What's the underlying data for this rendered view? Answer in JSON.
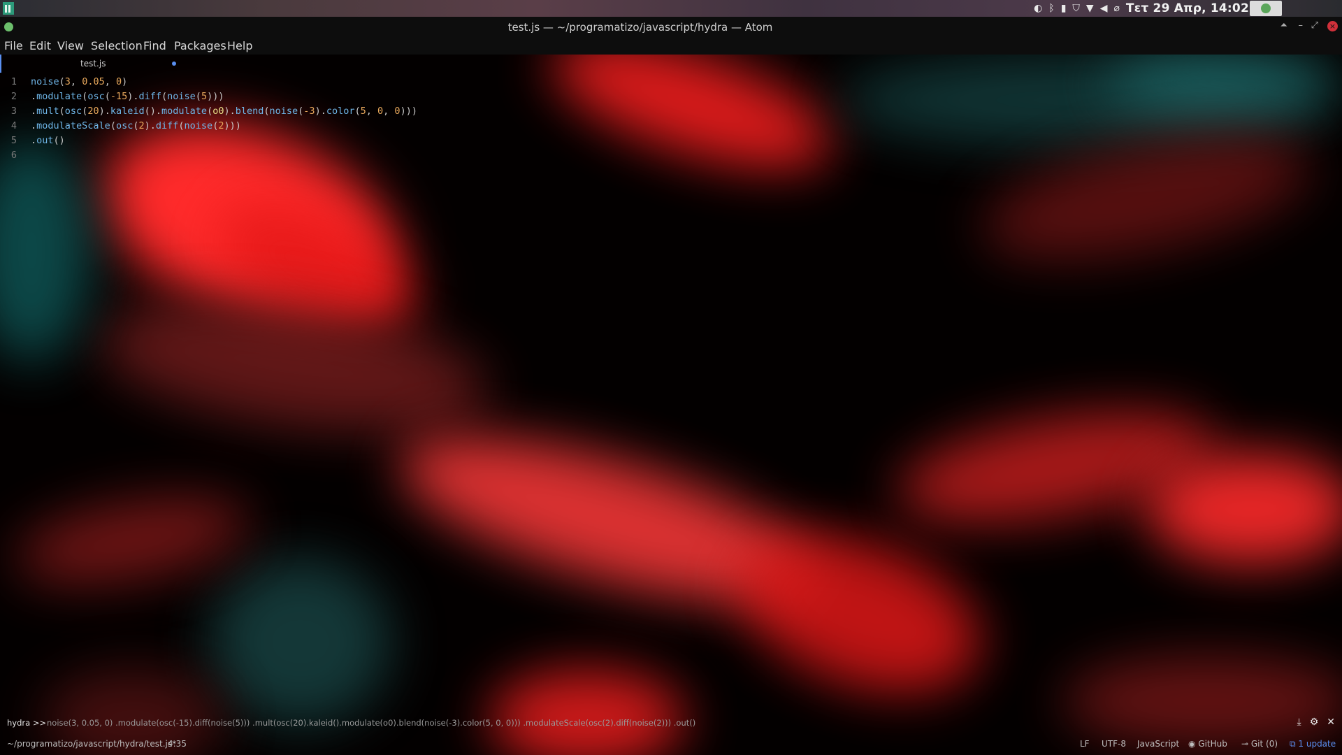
{
  "system_panel": {
    "clock": "Τετ 29 Απρ, 14:02",
    "tray_icons": [
      "steam-icon",
      "bluetooth-icon",
      "battery-icon",
      "shield-icon",
      "wifi-icon",
      "volume-icon",
      "paperclip-icon",
      "green-status-icon"
    ]
  },
  "window": {
    "title": "test.js — ~/programatizo/javascript/hydra — Atom"
  },
  "menu": {
    "file": "File",
    "edit": "Edit",
    "view": "View",
    "selection": "Selection",
    "find": "Find",
    "packages": "Packages",
    "help": "Help"
  },
  "tab": {
    "label": "test.js"
  },
  "editor": {
    "line_numbers": [
      "1",
      "2",
      "3",
      "4",
      "5",
      "6"
    ]
  },
  "console": {
    "prompt": "hydra >>",
    "command": "noise(3, 0.05, 0) .modulate(osc(-15).diff(noise(5))) .mult(osc(20).kaleid().modulate(o0).blend(noise(-3).color(5, 0, 0))) .modulateScale(osc(2).diff(noise(2))) .out()"
  },
  "status": {
    "path": "~/programatizo/javascript/hydra/test.js*",
    "cursor": "4:35",
    "line_ending": "LF",
    "encoding": "UTF-8",
    "grammar": "JavaScript",
    "github": "GitHub",
    "git": "Git (0)",
    "update": "1 update"
  },
  "colors": {
    "accent": "#5a8ff0",
    "function": "#6fb6e8",
    "number": "#e8a85c"
  }
}
